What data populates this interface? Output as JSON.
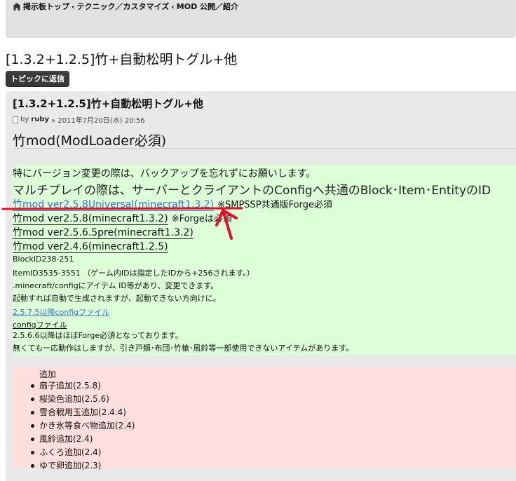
{
  "breadcrumb": {
    "home": "掲示板トップ",
    "items": [
      "テクニック／カスタマイズ",
      "MOD 公開／紹介"
    ],
    "separator": "‹"
  },
  "page_title": "[1.3.2+1.2.5]竹+自動松明トグル+他",
  "reply_button": "トピックに返信",
  "post": {
    "title": "[1.3.2+1.2.5]竹+自動松明トグル+他",
    "meta_by": "by",
    "author": "ruby",
    "date": "» 2011年7月20日(水) 20:56",
    "heading": "竹mod(ModLoader必須)",
    "warning": "特にバージョン変更の際は、バックアップを忘れずにお願いします。",
    "multiplayer": "マルチプレイの際は、サーバーとクライアントのConfigへ共通のBlock･Item･EntityのID",
    "downloads": [
      {
        "label": "竹mod ver2.5.8Universal(minecraft1.3.2)",
        "note": "※SMPSSP共通版Forge必須"
      },
      {
        "label": "竹mod ver2.5.8(minecraft1.3.2)",
        "note": "※Forgeは必須"
      },
      {
        "label": "竹mod ver2.5.6.5pre(minecraft1.3.2)",
        "note": ""
      },
      {
        "label": "竹mod ver2.4.6(minecraft1.2.5)",
        "note": ""
      }
    ],
    "block_id": "BlockID238-251",
    "item_id": "ItemID3535-3551 （ゲーム内IDは指定したIDから+256されます。）",
    "config_note": ".minecraft/configにアイテム ID等があり、変更できます。",
    "auto_note": "起動すれば自動で生成されますが、起動できない方向けに。",
    "config_link_1": "2.5.7.5以降configファイル",
    "config_link_2": "configファイル",
    "forge_note": "2.5.6.6以降はほぼForge必須となっております。",
    "no_forge_note": "無くても一応動作はしますが、引き戸類･布団･竹槍･風鈴等一部使用できないアイテムがあります。",
    "additions_title": "追加",
    "additions": [
      "扇子追加(2.5.8)",
      "桜染色追加(2.5.6)",
      "雪合戦用玉追加(2.4.4)",
      "かき氷等食べ物追加(2.4)",
      "風鈴追加(2.4)",
      "ふくろ追加(2.4)",
      "ゆで卵追加(2.3)"
    ]
  },
  "colors": {
    "green_bg": "#dcffd8",
    "pink_bg": "#ffdede",
    "link_blue": "#3d72c7",
    "annotation_red": "#e0102a"
  }
}
